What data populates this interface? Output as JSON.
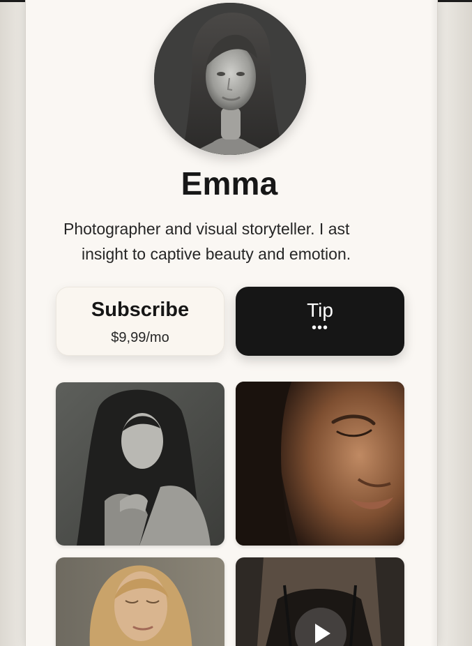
{
  "profile": {
    "name": "Emma",
    "bio_line1": "Photographer and visual storyteller. I ast",
    "bio_line2": "insight to captive beauty and emotion.",
    "avatar_icon": "portrait-avatar"
  },
  "actions": {
    "subscribe_label": "Subscribe",
    "subscribe_price": "$9,99/mo",
    "tip_label": "Tip",
    "tip_more": "•••"
  },
  "gallery": {
    "items": [
      {
        "kind": "photo",
        "tone": "monochrome"
      },
      {
        "kind": "photo",
        "tone": "warm-brown"
      },
      {
        "kind": "photo",
        "tone": "golden"
      },
      {
        "kind": "video",
        "tone": "dark",
        "icon": "play-icon"
      }
    ]
  },
  "colors": {
    "background": "#faf7f3",
    "text": "#171717",
    "tip_button": "#161616",
    "subscribe_button": "#faf6f0"
  }
}
